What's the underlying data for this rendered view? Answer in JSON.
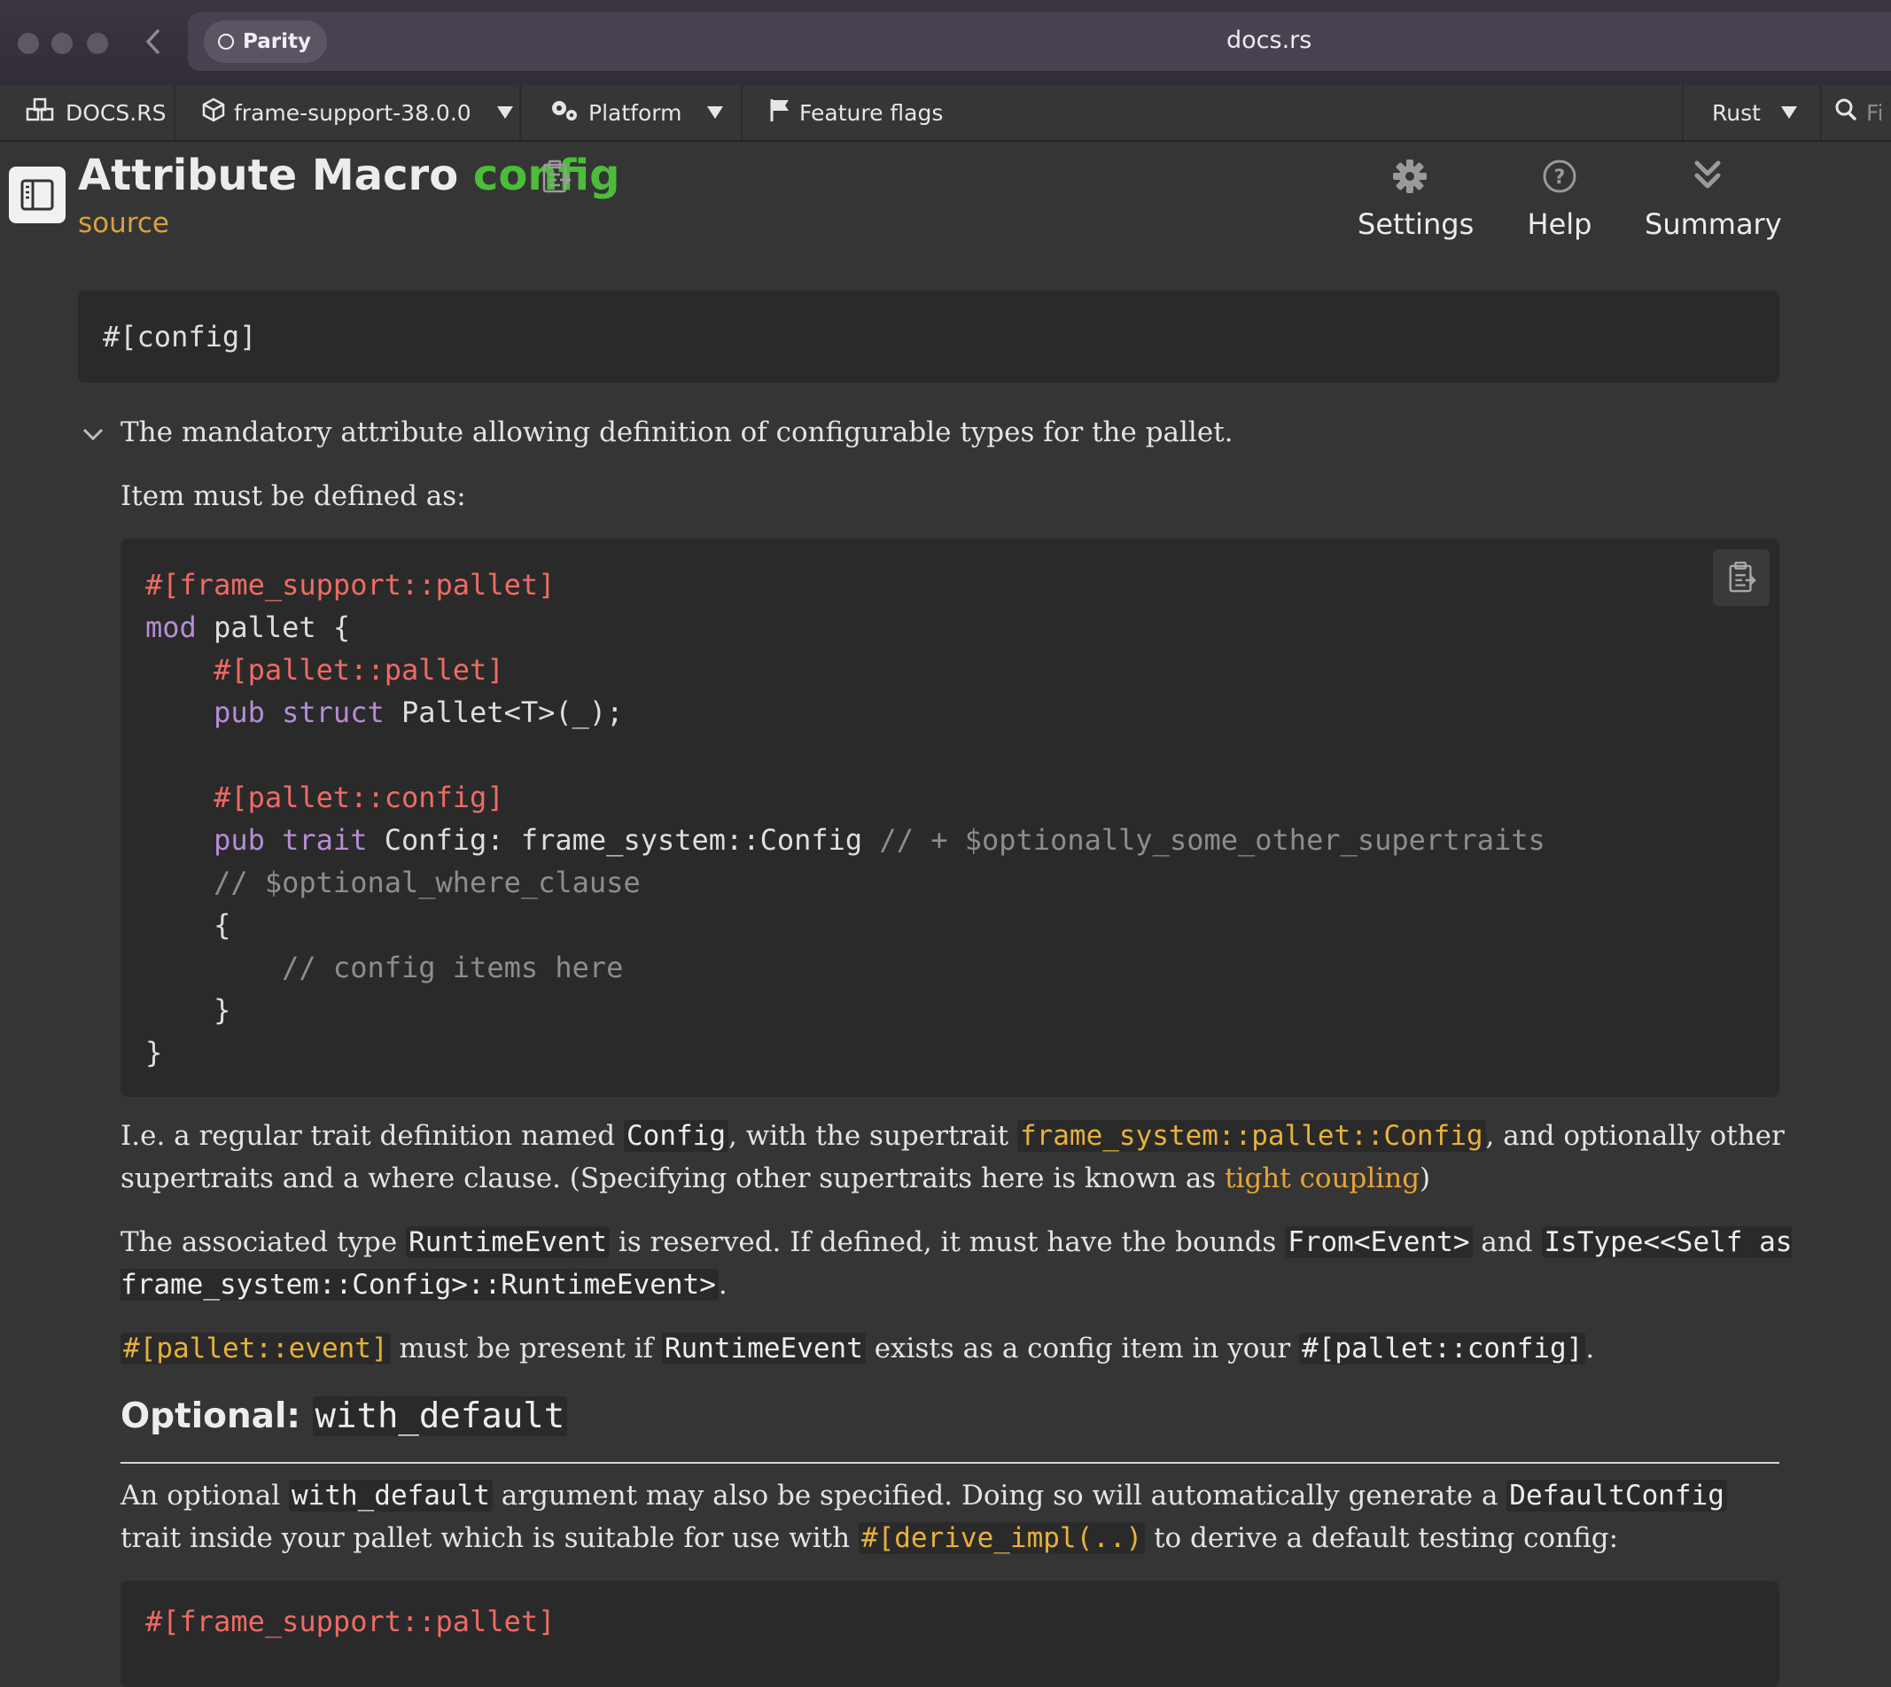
{
  "browser": {
    "tab_label": "Parity",
    "url": "docs.rs"
  },
  "nav": {
    "logo": "DOCS.RS",
    "crate": "frame-support-38.0.0",
    "platform": "Platform",
    "feature_flags": "Feature flags",
    "lang": "Rust",
    "search_placeholder": "Fi"
  },
  "header": {
    "kind": "Attribute Macro",
    "name": "config",
    "source": "source",
    "settings": "Settings",
    "help": "Help",
    "summary": "Summary"
  },
  "signature": "#[config]",
  "summary_line": "The mandatory attribute allowing definition of configurable types for the pallet.",
  "item_intro": "Item must be defined as:",
  "code1": {
    "l1": "#[frame_support::pallet]",
    "l2a": "mod",
    "l2b": " pallet {",
    "l3": "#[pallet::pallet]",
    "l4a": "pub",
    "l4b": "struct",
    "l4c": " Pallet<T>(_);",
    "l6": "#[pallet::config]",
    "l7a": "pub",
    "l7b": "trait",
    "l7c": " Config: frame_system::Config ",
    "l7d": "// + $optionally_some_other_supertraits",
    "l8": "// $optional_where_clause",
    "l9": "{",
    "l10": "// config items here",
    "l11": "}",
    "l12": "}"
  },
  "para1": {
    "t1": "I.e. a regular trait definition named ",
    "c1": "Config",
    "t2": ", with the supertrait ",
    "c2": "frame_system::pallet::Config",
    "t3": ", and optionally other supertraits and a where clause. (Specifying other supertraits here is known as ",
    "link": "tight coupling",
    "t4": ")"
  },
  "para2": {
    "t1": "The associated type ",
    "c1": "RuntimeEvent",
    "t2": " is reserved. If defined, it must have the bounds ",
    "c2": "From<Event>",
    "t3": " and ",
    "c3": "IsType<<Self as frame_system::Config>::RuntimeEvent>",
    "t4": "."
  },
  "para3": {
    "c1": "#[pallet::event]",
    "t1": " must be present if ",
    "c2": "RuntimeEvent",
    "t2": " exists as a config item in your ",
    "c3": "#[pallet::config]",
    "t3": "."
  },
  "optional": {
    "label": "Optional:",
    "code": "with_default"
  },
  "para4": {
    "t1": "An optional ",
    "c1": "with_default",
    "t2": " argument may also be specified. Doing so will automatically generate a ",
    "c2": "DefaultConfig",
    "t3": " trait inside your pallet which is suitable for use with ",
    "c3": "#[derive_impl(..)",
    "t4": " to derive a default testing config:"
  },
  "code2": {
    "l1": "#[frame_support::pallet]"
  }
}
